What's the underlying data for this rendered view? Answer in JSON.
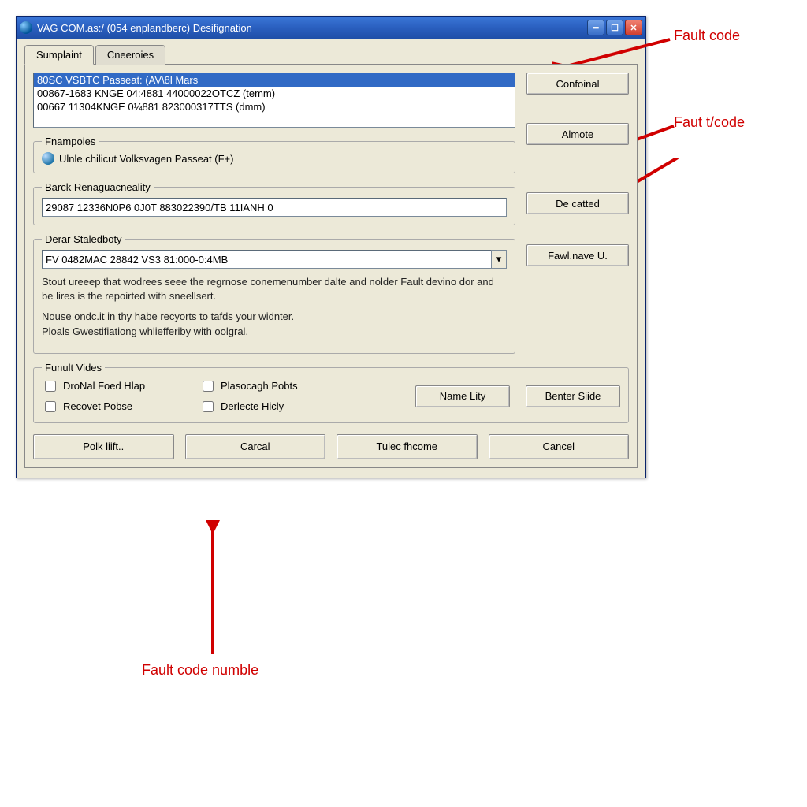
{
  "window": {
    "title": "VAG COM.as:/ (054 enplandberc) Desifignation"
  },
  "tabs": [
    {
      "label": "Sumplaint",
      "active": true
    },
    {
      "label": "Cneeroies",
      "active": false
    }
  ],
  "list": {
    "items": [
      "80SC VSBTC Passeat: (AV\\8l Mars",
      "00867-1683 KNGE 04:4881 44000022OTCZ  (temm)",
      "00667 11304KNGE 0¼881 823000317TTS  (dmm)"
    ],
    "selected_index": 0
  },
  "side_buttons": {
    "confoinal": "Confoinal",
    "almote": "Almote",
    "decatted": "De catted",
    "fawlnave": "Fawl.nave U."
  },
  "frampoies": {
    "legend": "Fnampoies",
    "text": "Ulnle chilicut Volksvagen Passeat (F+)"
  },
  "barck": {
    "legend": "Barck Renaguacneality",
    "value": "29087 12336N0P6 0J0T 883022390/TB 11IANH 0"
  },
  "derar": {
    "legend": "Derar Staledboty",
    "value": "FV 0482MAC 28842 VS3 81:000-0:4MB",
    "desc1": "Stout ureeep that wodrees seee the regrnose conemenumber dalte and nolder Fault devino dor and be lires is the repoirted with sneellsert.",
    "desc2": "Nouse ondc.it in thy habe recyorts to tafds your widnter.\nPloals Gwestifiationg whliefferiby with oolgral."
  },
  "funult": {
    "legend": "Funult Vides",
    "checkboxes": [
      "DroNal Foed Hlap",
      "Plasocagh Pobts",
      "Recovet Pobse",
      "Derlecte Hicly"
    ],
    "name_lity": "Name Lity",
    "benter_siide": "Benter Siide"
  },
  "bottom": {
    "polk": "Polk liift..",
    "carcal": "Carcal",
    "tulec": "Tulec fhcome",
    "cancel": "Cancel"
  },
  "annotations": {
    "fault_code": "Fault code",
    "faut_tcode": "Faut t/code",
    "fault_code_numble": "Fault code numble"
  },
  "colors": {
    "annotation": "#d00000",
    "titlebar": "#2a5fbf",
    "selection": "#316ac5"
  }
}
